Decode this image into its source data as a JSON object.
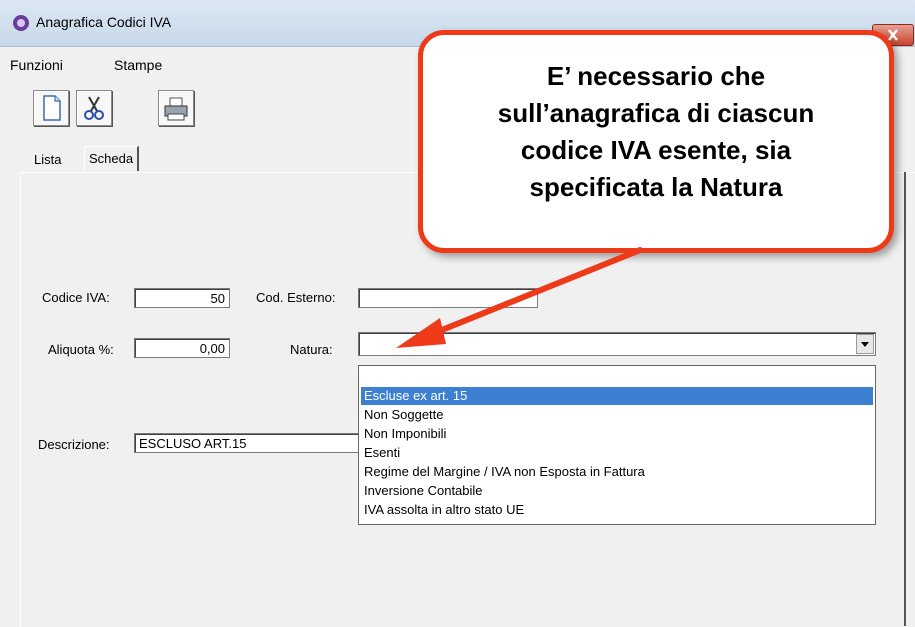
{
  "window": {
    "title": "Anagrafica Codici IVA",
    "icons": {
      "app": "app-icon",
      "close": "close-icon"
    }
  },
  "menu": [
    "Funzioni",
    "Stampe"
  ],
  "toolbar": {
    "buttons": [
      "new-document-icon",
      "cut-icon",
      "print-icon"
    ]
  },
  "tabs": [
    "Lista",
    "Scheda"
  ],
  "form": {
    "codice_label": "Codice IVA:",
    "codice_value": "50",
    "cod_esterno_label": "Cod. Esterno:",
    "cod_esterno_value": "",
    "aliquota_label": "Aliquota %:",
    "aliquota_value": "0,00",
    "natura_label": "Natura:",
    "natura_value": "",
    "descrizione_label": "Descrizione:",
    "descrizione_value": "ESCLUSO ART.15"
  },
  "natura_options": [
    "",
    "Escluse ex art. 15",
    "Non Soggette",
    "Non Imponibili",
    "Esenti",
    "Regime del Margine / IVA non Esposta in Fattura",
    "Inversione Contabile",
    "IVA assolta in altro stato UE"
  ],
  "natura_selected_index": 1,
  "callout": {
    "lines": [
      "E’ necessario che",
      "sull’anagrafica di ciascun",
      "codice IVA esente, sia",
      "specificata la Natura"
    ],
    "border_color": "#ee3a18"
  }
}
